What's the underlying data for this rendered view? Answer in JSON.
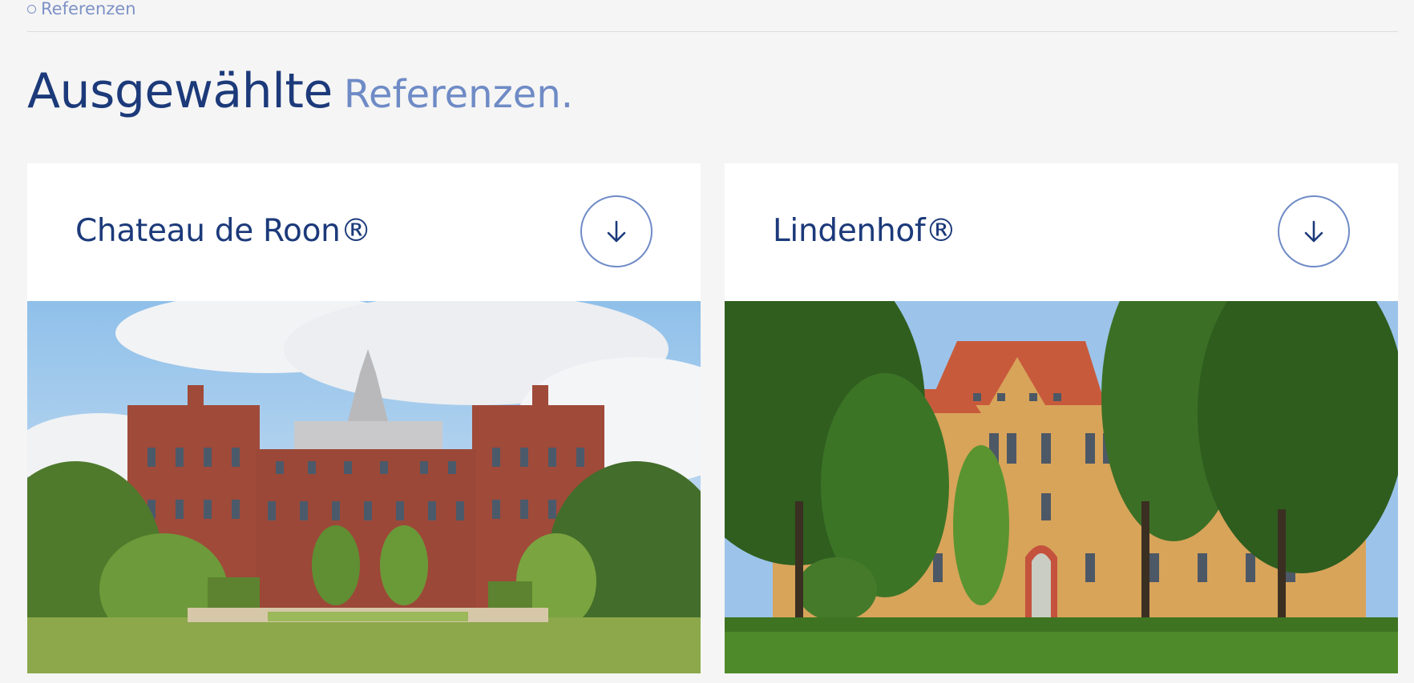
{
  "section": {
    "label": "Referenzen"
  },
  "heading": {
    "main": "Ausgewählte",
    "accent": "Referenzen."
  },
  "cards": [
    {
      "title": "Chateau de Roon®",
      "image": "red-brick-castle-building-photo"
    },
    {
      "title": "Lindenhof®",
      "image": "yellow-brick-building-with-trees-photo"
    }
  ],
  "colors": {
    "brand_dark": "#1c3a7a",
    "brand_light": "#6f8bc6",
    "background": "#f5f5f5"
  }
}
